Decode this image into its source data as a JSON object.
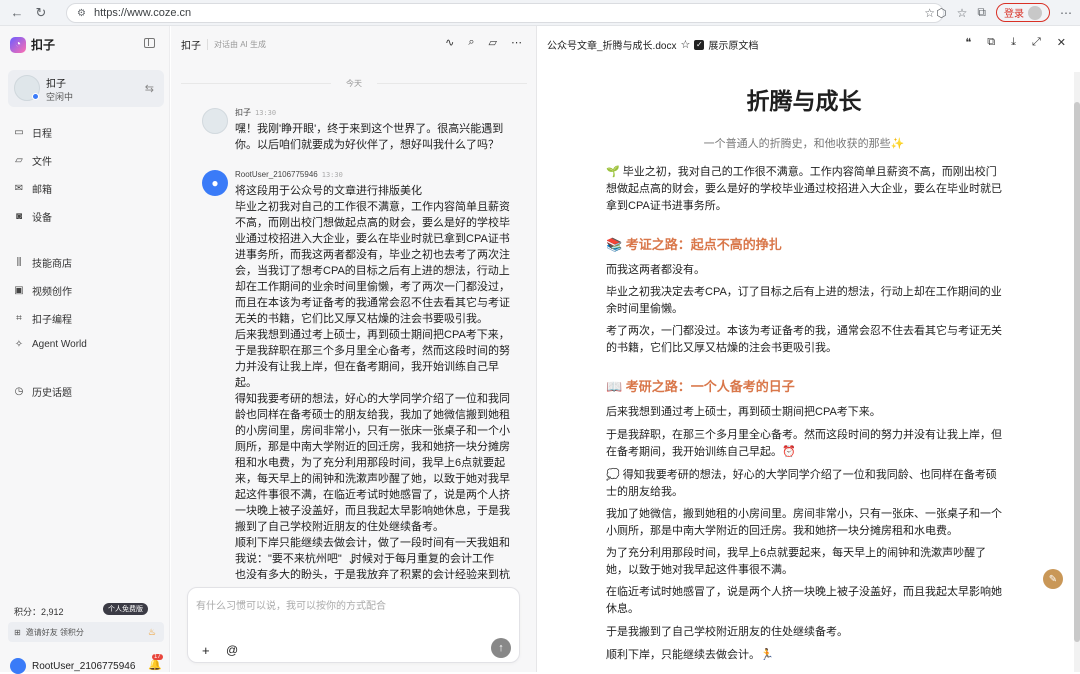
{
  "browser": {
    "url": "https://www.coze.cn",
    "login_label": "登录"
  },
  "sidebar": {
    "app_name": "扣子",
    "bot": {
      "name": "扣子",
      "status": "空闲中"
    },
    "items": [
      {
        "label": "日程",
        "icon": "calendar-icon"
      },
      {
        "label": "文件",
        "icon": "folder-icon"
      },
      {
        "label": "邮箱",
        "icon": "mail-icon"
      },
      {
        "label": "设备",
        "icon": "device-icon"
      },
      {
        "label": "技能商店",
        "icon": "skill-store-icon"
      },
      {
        "label": "视频创作",
        "icon": "video-icon"
      },
      {
        "label": "扣子编程",
        "icon": "code-icon"
      },
      {
        "label": "Agent World",
        "icon": "agent-world-icon"
      },
      {
        "label": "历史话题",
        "icon": "history-icon"
      }
    ],
    "points_label": "积分：2,912",
    "plan_label": "个人免费版",
    "invite_label": "邀请好友 领积分",
    "user_name": "RootUser_2106775946",
    "notification_count": "17"
  },
  "chat": {
    "title": "扣子",
    "subtitle": "对话由 AI 生成",
    "date_divider": "今天",
    "messages": [
      {
        "sender": "扣子",
        "time": "13:30",
        "text": "嘿！我刚'睁开眼'，终于来到这个世界了。很高兴能遇到\n你。以后咱们就要成为好伙伴了，想好叫我什么了吗？"
      },
      {
        "sender": "RootUser_2106775946",
        "time": "13:30",
        "text": "将这段用于公众号的文章进行排版美化\n毕业之初我对自己的工作很不满意，工作内容简单且薪资\n不高，而刚出校门想做起点高的财会，要么是好的学校毕\n业通过校招进入大企业，要么在毕业时就已拿到CPA证书\n进事务所，而我这两者都没有，毕业之初也去考了两次注\n会，当我订了想考CPA的目标之后有上进的想法，行动上\n却在工作期间的业余时间里偷懒，考了两次一门都没过，\n而且在本该为考证备考的我通常会忍不住去看其它与考证\n无关的书籍，它们比又厚又枯燥的注会书要吸引我。\n后来我想到通过考上硕士，再到硕士期间把CPA考下来，\n于是我辞职在那三个多月里全心备考，然而这段时间的努\n力并没有让我上岸，但在备考期间，我开始训练自己早\n起。\n得知我要考研的想法，好心的大学同学介绍了一位和我同\n龄也同样在备考硕士的朋友给我，我加了她微信搬到她租\n的小房间里，房间非常小，只有一张床一张桌子和一个小\n厕所，那是中南大学附近的回迁房，我和她挤一块分摊房\n租和水电费，为了充分利用那段时间，我早上6点就要起\n来，每天早上的闹钟和洗漱声吵醒了她，以致于她对我早\n起这件事很不满，在临近考试时她感冒了，说是两个人挤\n一块晚上被子没盖好，而且我起太早影响她休息，于是我\n搬到了自己学校附近朋友的住处继续备考。\n顺利下岸只能继续去做会计，做了一段时间有一天我姐和\n我说：\"要不来杭州吧\"   时候对于每月重复的会计工作\n也没有多大的盼头，于是我放弃了积累的会计经验来到杭"
      }
    ],
    "input_placeholder": "有什么习惯可以说，我可以按你的方式配合"
  },
  "doc": {
    "file_name": "公众号文章_折腾与成长.docx",
    "show_original_label": "展示原文档",
    "title": "折腾与成长",
    "subtitle": "一个普通人的折腾史，和他收获的那些✨",
    "blocks": [
      {
        "kind": "p",
        "text": "🌱 毕业之初，我对自己的工作很不满意。工作内容简单且薪资不高，而刚出校门想做起点高的财会，要么是好的学校毕业通过校招进入大企业，要么在毕业时就已拿到CPA证书进事务所。"
      },
      {
        "kind": "h",
        "text": "📚 考证之路：起点不高的挣扎"
      },
      {
        "kind": "p",
        "text": "而我这两者都没有。"
      },
      {
        "kind": "p",
        "text": "毕业之初我决定去考CPA，订了目标之后有上进的想法，行动上却在工作期间的业余时间里偷懒。"
      },
      {
        "kind": "p",
        "text": "考了两次，一门都没过。本该为考证备考的我，通常会忍不住去看其它与考证无关的书籍，它们比又厚又枯燥的注会书更吸引我。"
      },
      {
        "kind": "h",
        "text": "📖 考研之路：一个人备考的日子"
      },
      {
        "kind": "p",
        "text": "后来我想到通过考上硕士，再到硕士期间把CPA考下来。"
      },
      {
        "kind": "p",
        "text": "于是我辞职，在那三个多月里全心备考。然而这段时间的努力并没有让我上岸，但在备考期间，我开始训练自己早起。⏰"
      },
      {
        "kind": "p",
        "text": "💭 得知我要考研的想法，好心的大学同学介绍了一位和我同龄、也同样在备考硕士的朋友给我。"
      },
      {
        "kind": "p",
        "text": "我加了她微信，搬到她租的小房间里。房间非常小，只有一张床、一张桌子和一个小厕所，那是中南大学附近的回迁房。我和她挤一块分摊房租和水电费。"
      },
      {
        "kind": "p",
        "text": "为了充分利用那段时间，我早上6点就要起来，每天早上的闹钟和洗漱声吵醒了她，以致于她对我早起这件事很不满。"
      },
      {
        "kind": "p",
        "text": "在临近考试时她感冒了，说是两个人挤一块晚上被子没盖好，而且我起太早影响她休息。"
      },
      {
        "kind": "p",
        "text": "于是我搬到了自己学校附近朋友的住处继续备考。"
      },
      {
        "kind": "p",
        "text": "顺利下岸，只能继续去做会计。🏃"
      }
    ]
  }
}
